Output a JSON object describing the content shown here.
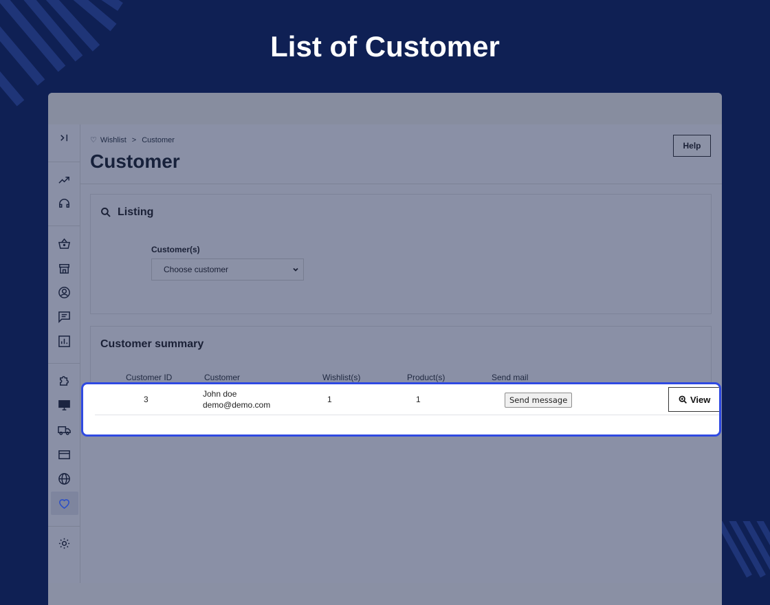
{
  "page": {
    "title": "List of Customer"
  },
  "breadcrumb": {
    "parent": "Wishlist",
    "separator": ">",
    "current": "Customer"
  },
  "header": {
    "title": "Customer",
    "help_label": "Help"
  },
  "listing": {
    "title": "Listing",
    "field_label": "Customer(s)",
    "select_value": "Choose customer"
  },
  "summary": {
    "title": "Customer summary",
    "columns": [
      "Customer ID",
      "Customer",
      "Wishlist(s)",
      "Product(s)",
      "Send mail"
    ],
    "rows": [
      {
        "id": "3",
        "name": "John doe",
        "email": "demo@demo.com",
        "wishlists": "1",
        "products": "1",
        "send_label": "Send message",
        "view_label": "View"
      }
    ]
  },
  "sidebar": {
    "icons": [
      "expand-icon",
      "trending-icon",
      "support-icon",
      "basket-icon",
      "store-icon",
      "customer-icon",
      "message-icon",
      "stats-icon",
      "puzzle-icon",
      "monitor-icon",
      "truck-icon",
      "payment-icon",
      "globe-icon",
      "heart-icon",
      "settings-icon"
    ],
    "active": "heart-icon"
  },
  "colors": {
    "background": "#0f2054",
    "highlight_border": "#2f4ae2",
    "overlay": "#8a90a6"
  }
}
